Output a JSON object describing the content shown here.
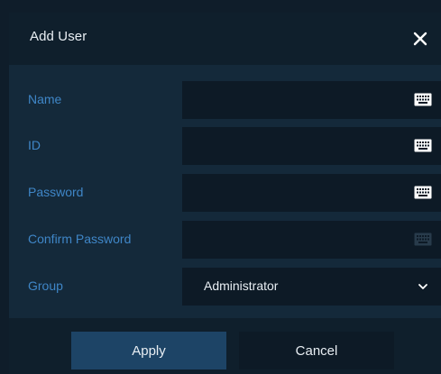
{
  "dialog": {
    "title": "Add User"
  },
  "form": {
    "name_label": "Name",
    "id_label": "ID",
    "password_label": "Password",
    "confirm_password_label": "Confirm Password",
    "group_label": "Group",
    "name_value": "",
    "id_value": "",
    "password_value": "",
    "confirm_password_value": "",
    "group_selected": "Administrator"
  },
  "buttons": {
    "apply_label": "Apply",
    "cancel_label": "Cancel"
  },
  "icons": {
    "close": "close-icon",
    "keyboard": "keyboard-icon",
    "chevron": "chevron-down-icon"
  },
  "colors": {
    "label": "#3f86c7",
    "apply_button": "#1d4466",
    "field_bg": "#0d1a26"
  }
}
